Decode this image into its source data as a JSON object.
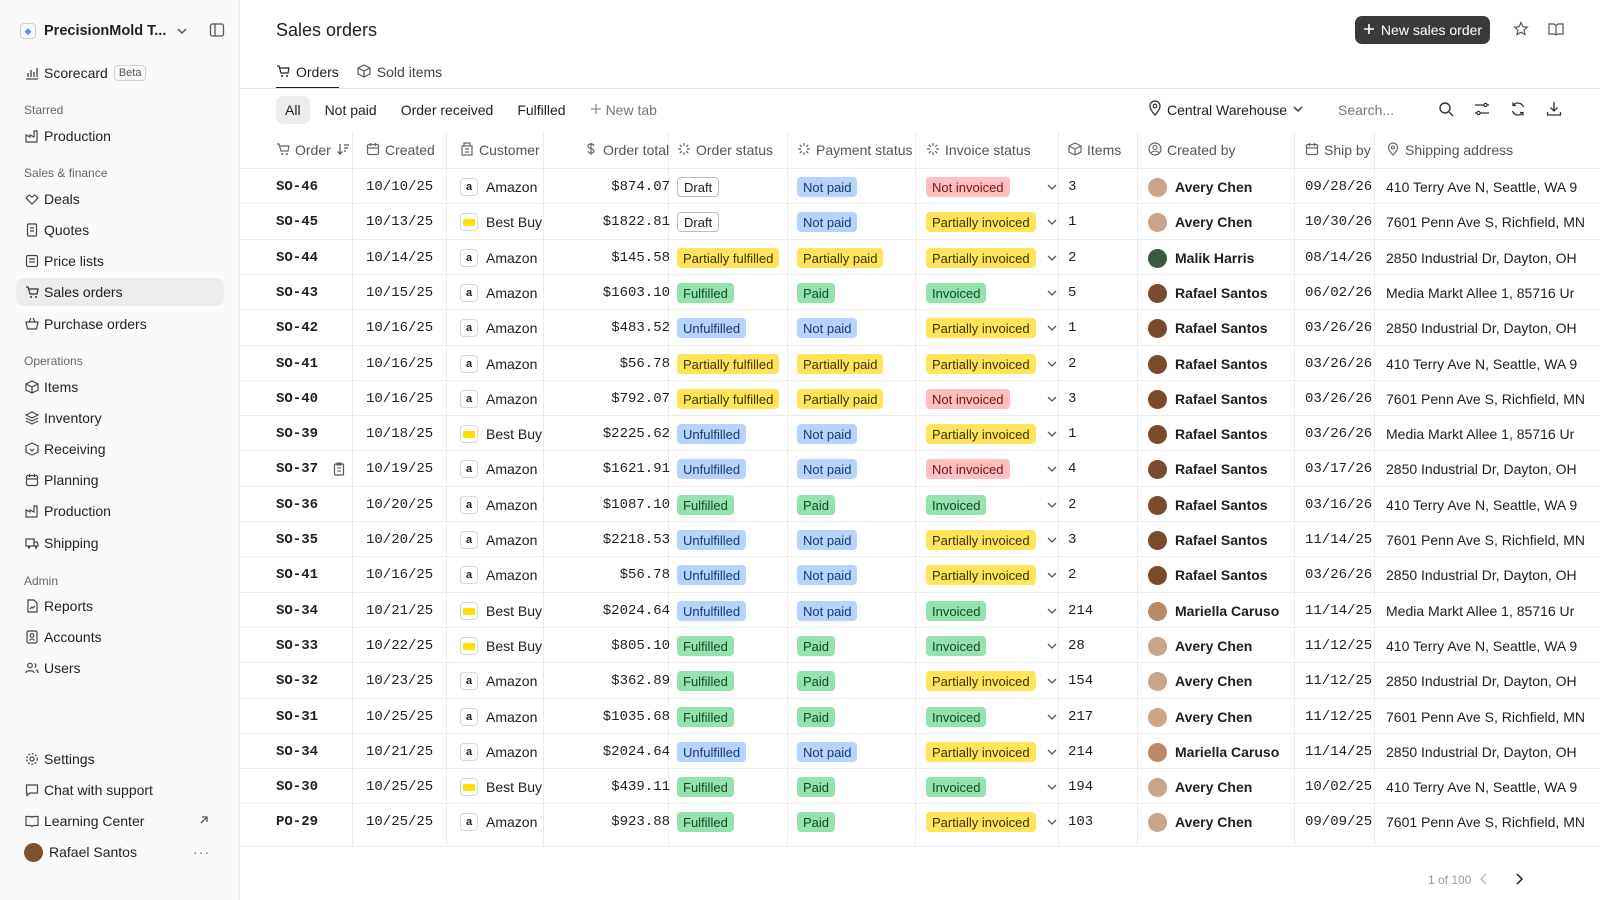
{
  "workspace": {
    "name": "PrecisionMold T..."
  },
  "sidebar": {
    "scorecard": "Scorecard",
    "beta": "Beta",
    "starred_label": "Starred",
    "starred": [
      {
        "label": "Production"
      }
    ],
    "sales_label": "Sales & finance",
    "sales": [
      {
        "label": "Deals"
      },
      {
        "label": "Quotes"
      },
      {
        "label": "Price lists"
      },
      {
        "label": "Sales orders"
      },
      {
        "label": "Purchase orders"
      }
    ],
    "ops_label": "Operations",
    "ops": [
      {
        "label": "Items"
      },
      {
        "label": "Inventory"
      },
      {
        "label": "Receiving"
      },
      {
        "label": "Planning"
      },
      {
        "label": "Production"
      },
      {
        "label": "Shipping"
      }
    ],
    "admin_label": "Admin",
    "admin": [
      {
        "label": "Reports"
      },
      {
        "label": "Accounts"
      },
      {
        "label": "Users"
      }
    ],
    "settings": "Settings",
    "chat": "Chat with support",
    "learning": "Learning Center",
    "user": "Rafael Santos",
    "more": "···"
  },
  "header": {
    "title": "Sales orders",
    "new_button": "New sales order",
    "tabs": [
      "Orders",
      "Sold items"
    ]
  },
  "filters": {
    "tabs": [
      "All",
      "Not paid",
      "Order received",
      "Fulfilled"
    ],
    "new_tab": "New tab",
    "location": "Central Warehouse",
    "search_placeholder": "Search..."
  },
  "columns": [
    "Order",
    "Created",
    "Customer",
    "Order total",
    "Order status",
    "Payment status",
    "Invoice status",
    "Items",
    "Created by",
    "Ship by",
    "Shipping address"
  ],
  "rows": [
    {
      "order": "SO-46",
      "created": "10/10/25",
      "customer": "Amazon",
      "total": "$874.07",
      "ostatus": "Draft",
      "pstatus": "Not paid",
      "istatus": "Not invoiced",
      "items": "3",
      "by": "Avery Chen",
      "ship": "09/28/26",
      "addr": "410 Terry Ave N, Seattle, WA 9"
    },
    {
      "order": "SO-45",
      "created": "10/13/25",
      "customer": "Best Buy",
      "total": "$1822.81",
      "ostatus": "Draft",
      "pstatus": "Not paid",
      "istatus": "Partially invoiced",
      "items": "1",
      "by": "Avery Chen",
      "ship": "10/30/26",
      "addr": "7601 Penn Ave S, Richfield, MN"
    },
    {
      "order": "SO-44",
      "created": "10/14/25",
      "customer": "Amazon",
      "total": "$145.58",
      "ostatus": "Partially fulfilled",
      "pstatus": "Partially paid",
      "istatus": "Partially invoiced",
      "items": "2",
      "by": "Malik Harris",
      "ship": "08/14/26",
      "addr": "2850 Industrial Dr, Dayton, OH"
    },
    {
      "order": "SO-43",
      "created": "10/15/25",
      "customer": "Amazon",
      "total": "$1603.10",
      "ostatus": "Fulfilled",
      "pstatus": "Paid",
      "istatus": "Invoiced",
      "items": "5",
      "by": "Rafael Santos",
      "ship": "06/02/26",
      "addr": "Media Markt Allee 1, 85716 Ur"
    },
    {
      "order": "SO-42",
      "created": "10/16/25",
      "customer": "Amazon",
      "total": "$483.52",
      "ostatus": "Unfulfilled",
      "pstatus": "Not paid",
      "istatus": "Partially invoiced",
      "items": "1",
      "by": "Rafael Santos",
      "ship": "03/26/26",
      "addr": "2850 Industrial Dr, Dayton, OH"
    },
    {
      "order": "SO-41",
      "created": "10/16/25",
      "customer": "Amazon",
      "total": "$56.78",
      "ostatus": "Partially fulfilled",
      "pstatus": "Partially paid",
      "istatus": "Partially invoiced",
      "items": "2",
      "by": "Rafael Santos",
      "ship": "03/26/26",
      "addr": "410 Terry Ave N, Seattle, WA 9"
    },
    {
      "order": "SO-40",
      "created": "10/16/25",
      "customer": "Amazon",
      "total": "$792.07",
      "ostatus": "Partially fulfilled",
      "pstatus": "Partially paid",
      "istatus": "Not invoiced",
      "items": "3",
      "by": "Rafael Santos",
      "ship": "03/26/26",
      "addr": "7601 Penn Ave S, Richfield, MN"
    },
    {
      "order": "SO-39",
      "created": "10/18/25",
      "customer": "Best Buy",
      "total": "$2225.62",
      "ostatus": "Unfulfilled",
      "pstatus": "Not paid",
      "istatus": "Partially invoiced",
      "items": "1",
      "by": "Rafael Santos",
      "ship": "03/26/26",
      "addr": "Media Markt Allee 1, 85716 Ur"
    },
    {
      "order": "SO-37",
      "created": "10/19/25",
      "customer": "Amazon",
      "total": "$1621.91",
      "ostatus": "Unfulfilled",
      "pstatus": "Not paid",
      "istatus": "Not invoiced",
      "items": "4",
      "by": "Rafael Santos",
      "ship": "03/17/26",
      "addr": "2850 Industrial Dr, Dayton, OH",
      "note": true
    },
    {
      "order": "SO-36",
      "created": "10/20/25",
      "customer": "Amazon",
      "total": "$1087.10",
      "ostatus": "Fulfilled",
      "pstatus": "Paid",
      "istatus": "Invoiced",
      "items": "2",
      "by": "Rafael Santos",
      "ship": "03/16/26",
      "addr": "410 Terry Ave N, Seattle, WA 9"
    },
    {
      "order": "SO-35",
      "created": "10/20/25",
      "customer": "Amazon",
      "total": "$2218.53",
      "ostatus": "Unfulfilled",
      "pstatus": "Not paid",
      "istatus": "Partially invoiced",
      "items": "3",
      "by": "Rafael Santos",
      "ship": "11/14/25",
      "addr": "7601 Penn Ave S, Richfield, MN"
    },
    {
      "order": "SO-41",
      "created": "10/16/25",
      "customer": "Amazon",
      "total": "$56.78",
      "ostatus": "Unfulfilled",
      "pstatus": "Not paid",
      "istatus": "Partially invoiced",
      "items": "2",
      "by": "Rafael Santos",
      "ship": "03/26/26",
      "addr": "2850 Industrial Dr, Dayton, OH"
    },
    {
      "order": "SO-34",
      "created": "10/21/25",
      "customer": "Best Buy",
      "total": "$2024.64",
      "ostatus": "Unfulfilled",
      "pstatus": "Not paid",
      "istatus": "Invoiced",
      "items": "214",
      "by": "Mariella Caruso",
      "ship": "11/14/25",
      "addr": "Media Markt Allee 1, 85716 Ur"
    },
    {
      "order": "SO-33",
      "created": "10/22/25",
      "customer": "Best Buy",
      "total": "$805.10",
      "ostatus": "Fulfilled",
      "pstatus": "Paid",
      "istatus": "Invoiced",
      "items": "28",
      "by": "Avery Chen",
      "ship": "11/12/25",
      "addr": "410 Terry Ave N, Seattle, WA 9"
    },
    {
      "order": "SO-32",
      "created": "10/23/25",
      "customer": "Amazon",
      "total": "$362.89",
      "ostatus": "Fulfilled",
      "pstatus": "Paid",
      "istatus": "Partially invoiced",
      "items": "154",
      "by": "Avery Chen",
      "ship": "11/12/25",
      "addr": "2850 Industrial Dr, Dayton, OH"
    },
    {
      "order": "SO-31",
      "created": "10/25/25",
      "customer": "Amazon",
      "total": "$1035.68",
      "ostatus": "Fulfilled",
      "pstatus": "Paid",
      "istatus": "Invoiced",
      "items": "217",
      "by": "Avery Chen",
      "ship": "11/12/25",
      "addr": "7601 Penn Ave S, Richfield, MN"
    },
    {
      "order": "SO-34",
      "created": "10/21/25",
      "customer": "Amazon",
      "total": "$2024.64",
      "ostatus": "Unfulfilled",
      "pstatus": "Not paid",
      "istatus": "Partially invoiced",
      "items": "214",
      "by": "Mariella Caruso",
      "ship": "11/14/25",
      "addr": "2850 Industrial Dr, Dayton, OH"
    },
    {
      "order": "SO-30",
      "created": "10/25/25",
      "customer": "Best Buy",
      "total": "$439.11",
      "ostatus": "Fulfilled",
      "pstatus": "Paid",
      "istatus": "Invoiced",
      "items": "194",
      "by": "Avery Chen",
      "ship": "10/02/25",
      "addr": "410 Terry Ave N, Seattle, WA 9"
    },
    {
      "order": "PO-29",
      "created": "10/25/25",
      "customer": "Amazon",
      "total": "$923.88",
      "ostatus": "Fulfilled",
      "pstatus": "Paid",
      "istatus": "Partially invoiced",
      "items": "103",
      "by": "Avery Chen",
      "ship": "09/09/25",
      "addr": "7601 Penn Ave S, Richfield, MN"
    }
  ],
  "status_colors": {
    "Draft": "draft",
    "Unfulfilled": "blue",
    "Partially fulfilled": "yellow",
    "Fulfilled": "green",
    "Not paid": "blue",
    "Partially paid": "yellow",
    "Paid": "green",
    "Not invoiced": "red",
    "Partially invoiced": "yellow",
    "Invoiced": "green"
  },
  "avatar_colors": {
    "Avery Chen": "#c9a58a",
    "Malik Harris": "#3d5a3f",
    "Rafael Santos": "#7a4a2c",
    "Mariella Caruso": "#b98a67"
  },
  "pagination": {
    "text": "1 of 100"
  }
}
